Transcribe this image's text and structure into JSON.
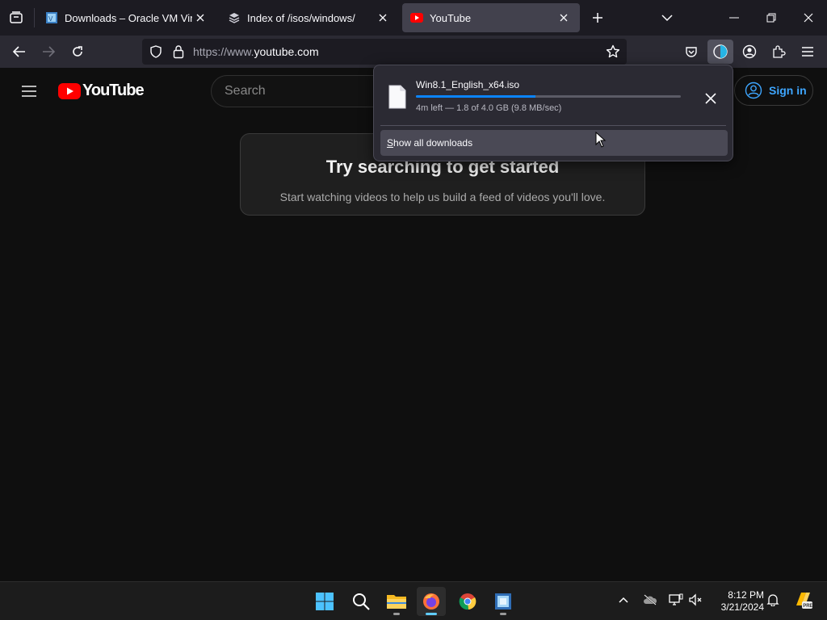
{
  "browser": {
    "tabs": [
      {
        "title": "Downloads – Oracle VM VirtualBox",
        "active": false
      },
      {
        "title": "Index of /isos/windows/",
        "active": false
      },
      {
        "title": "YouTube",
        "active": true
      }
    ],
    "url": {
      "prefix": "https://www.",
      "domain": "youtube.com"
    }
  },
  "youtube": {
    "logo_text": "YouTube",
    "search_placeholder": "Search",
    "sign_in_label": "Sign in",
    "empty_title": "Try searching to get started",
    "empty_subtitle": "Start watching videos to help us build a feed of videos you'll love."
  },
  "downloads_panel": {
    "filename": "Win8.1_English_x64.iso",
    "status": "4m left — 1.8 of 4.0 GB (9.8 MB/sec)",
    "progress_fraction": 0.45,
    "show_all_label": "Show all downloads",
    "show_all_accesskey": "S",
    "show_all_rest": "how all downloads"
  },
  "taskbar": {
    "time": "8:12 PM",
    "date": "3/21/2024"
  },
  "colors": {
    "accent_blue": "#0a84ff",
    "youtube_red": "#ff0000",
    "signin_blue": "#3ea6ff"
  }
}
